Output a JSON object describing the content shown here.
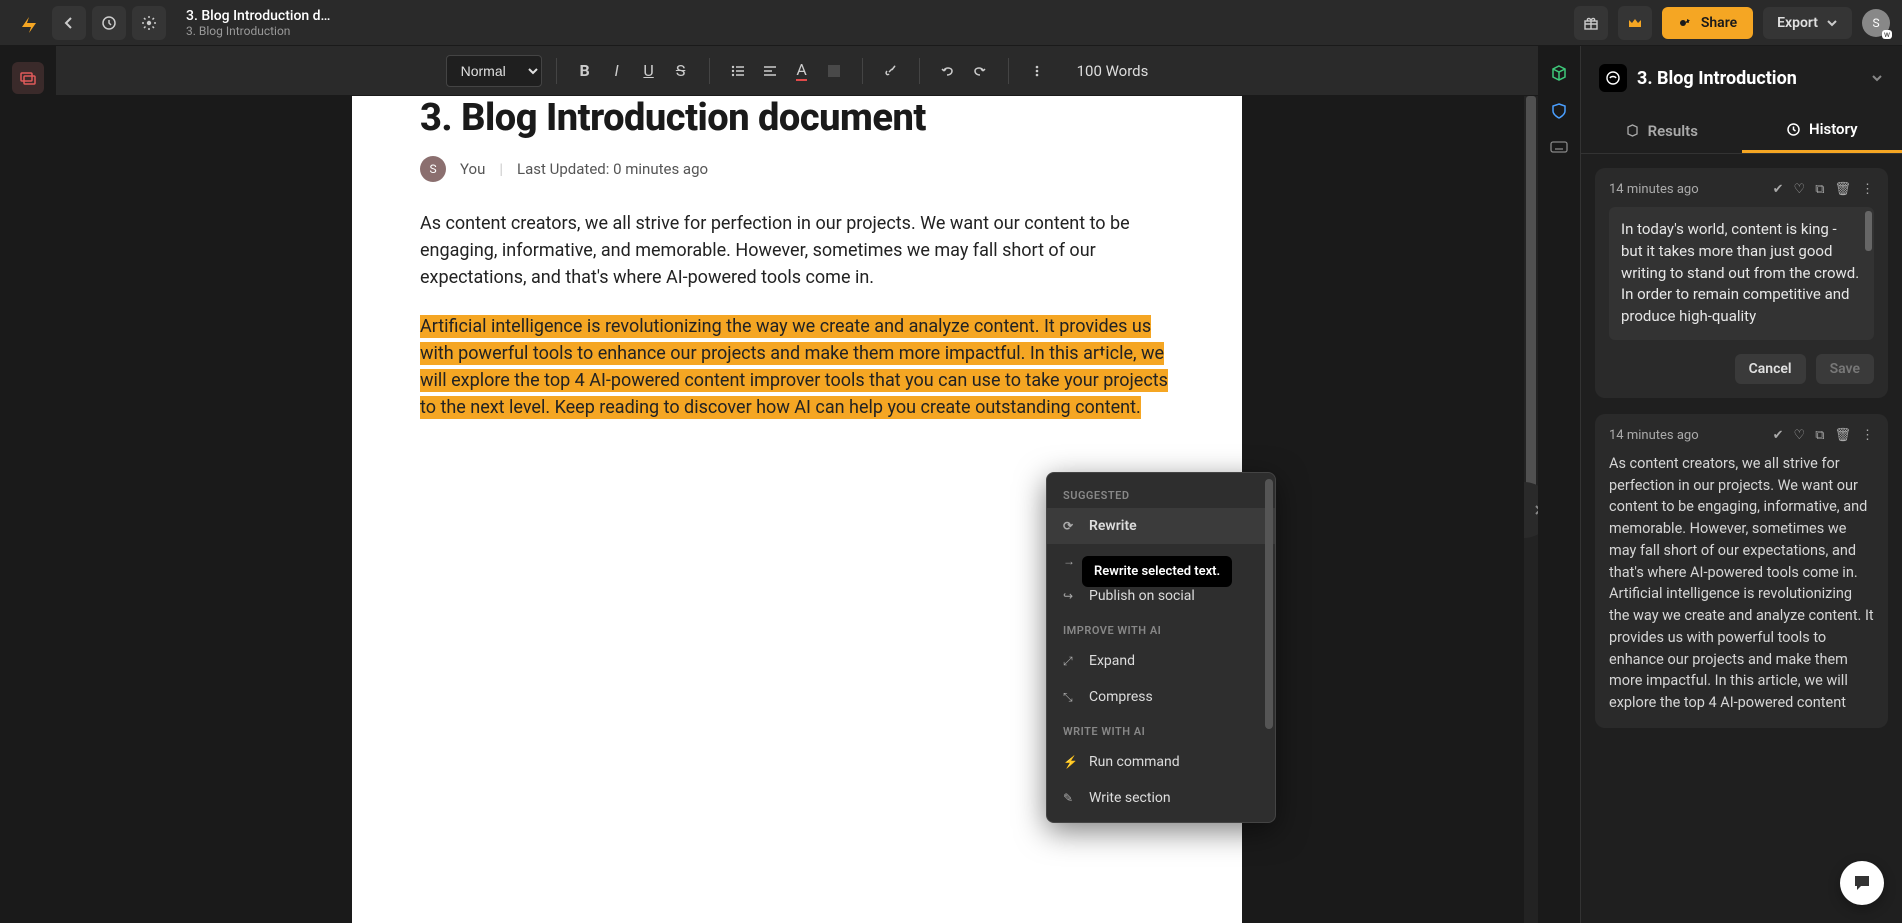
{
  "topbar": {
    "doc_title_short": "3. Blog Introduction d…",
    "doc_sub": "3. Blog Introduction",
    "share_label": "Share",
    "export_label": "Export",
    "avatar_letter": "S",
    "avatar_badge": "w"
  },
  "toolbar": {
    "style": "Normal",
    "words": "100 Words"
  },
  "document": {
    "heading": "3. Blog Introduction document",
    "author_initial": "S",
    "author": "You",
    "last_updated": "Last Updated: 0 minutes ago",
    "para1": "As content creators, we all strive for perfection in our projects. We want our content to be engaging, informative, and memorable. However, sometimes we may fall short of our expectations, and that's where AI-powered tools come in.",
    "para2_highlighted": "Artificial intelligence is revolutionizing the way we create and analyze content. It provides us with powerful tools to enhance our projects and make them more impactful. In this article, we will explore the top 4 AI-powered content improver tools that you can use to take your projects to the next level. Keep reading to discover how AI can help you create outstanding content."
  },
  "context_menu": {
    "section1": "SUGGESTED",
    "rewrite": "Rewrite",
    "continue": "",
    "publish": "Publish on social",
    "section2": "IMPROVE WITH AI",
    "expand": "Expand",
    "compress": "Compress",
    "section3": "WRITE WITH AI",
    "run_command": "Run command",
    "write_section": "Write section",
    "tooltip": "Rewrite selected text."
  },
  "panel": {
    "title": "3. Blog Introduction",
    "tab_results": "Results",
    "tab_history": "History",
    "card1": {
      "time": "14 minutes ago",
      "text": "In today's world, content is king - but it takes more than just good writing to stand out from the crowd. In order to remain competitive and produce high-quality",
      "cancel": "Cancel",
      "save": "Save"
    },
    "card2": {
      "time": "14 minutes ago",
      "text": "As content creators, we all strive for perfection in our projects. We want our content to be engaging, informative, and memorable. However, sometimes we may fall short of our expectations, and that's where AI-powered tools come in.\nArtificial intelligence is revolutionizing the way we create and analyze content. It provides us with powerful tools to enhance our projects and make them more impactful. In this article, we will explore the top 4 AI-powered content"
    }
  }
}
